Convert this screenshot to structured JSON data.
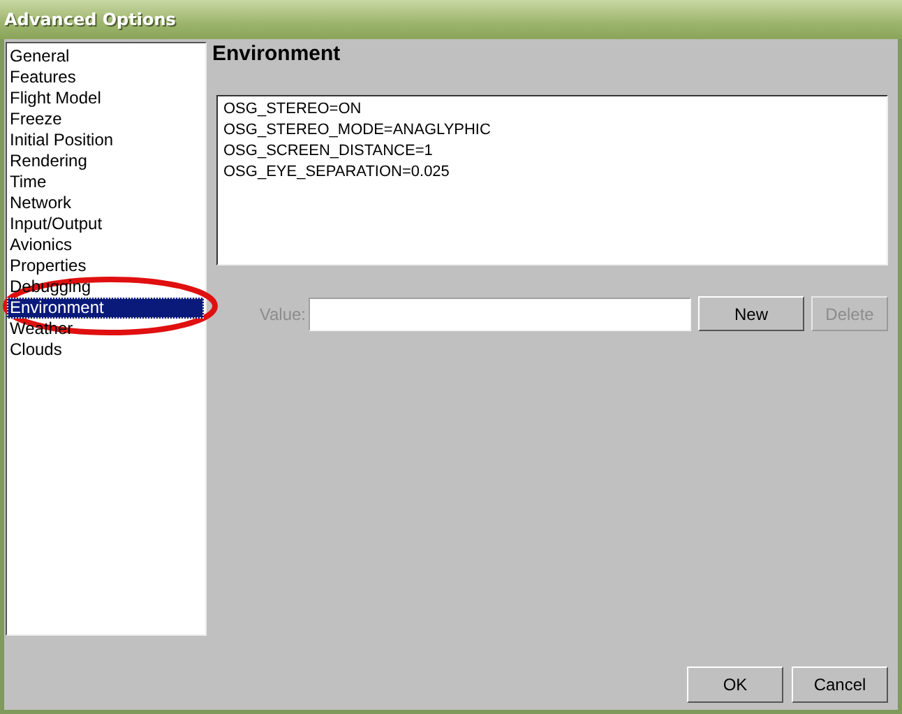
{
  "window": {
    "title": "Advanced Options"
  },
  "sidebar": {
    "items": [
      {
        "label": "General",
        "selected": false
      },
      {
        "label": "Features",
        "selected": false
      },
      {
        "label": "Flight Model",
        "selected": false
      },
      {
        "label": "Freeze",
        "selected": false
      },
      {
        "label": "Initial Position",
        "selected": false
      },
      {
        "label": "Rendering",
        "selected": false
      },
      {
        "label": "Time",
        "selected": false
      },
      {
        "label": "Network",
        "selected": false
      },
      {
        "label": "Input/Output",
        "selected": false
      },
      {
        "label": "Avionics",
        "selected": false
      },
      {
        "label": "Properties",
        "selected": false
      },
      {
        "label": "Debugging",
        "selected": false
      },
      {
        "label": "Environment",
        "selected": true
      },
      {
        "label": "Weather",
        "selected": false
      },
      {
        "label": "Clouds",
        "selected": false
      }
    ]
  },
  "panel": {
    "heading": "Environment",
    "entries": [
      "OSG_STEREO=ON",
      "OSG_STEREO_MODE=ANAGLYPHIC",
      "OSG_SCREEN_DISTANCE=1",
      "OSG_EYE_SEPARATION=0.025"
    ],
    "value_field": {
      "label": "Value:",
      "disabled": true
    },
    "buttons": [
      {
        "label": "New",
        "disabled": false
      },
      {
        "label": "Delete",
        "disabled": true
      }
    ]
  },
  "footer_buttons": [
    "OK",
    "Cancel"
  ]
}
